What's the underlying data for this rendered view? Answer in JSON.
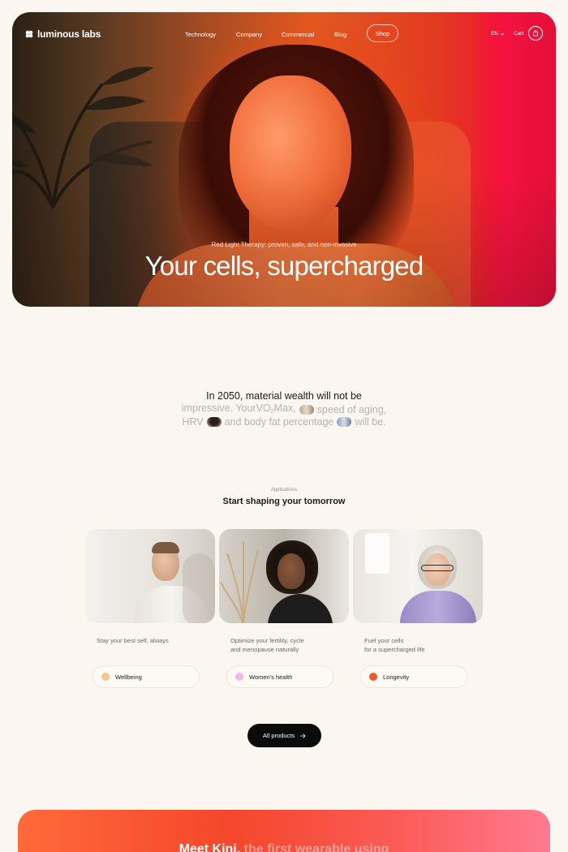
{
  "brand": {
    "name": "luminous labs",
    "logo_icon": "clover-logo-icon"
  },
  "nav": {
    "links": [
      "Technology",
      "Company",
      "Commercial",
      "Blog"
    ],
    "shop": "Shop",
    "language": "EN",
    "cart": "Cart"
  },
  "hero": {
    "subtitle": "Red Light Therapy: proven, safe, and non-invasive",
    "title": "Your cells, supercharged"
  },
  "statement": {
    "line1": "In 2050, material wealth will not be",
    "line2_a": "impressive. YourVO",
    "line2_sub": "2",
    "line2_b": "Max,",
    "line2_c": "speed of aging,",
    "line3_a": "HRV",
    "line3_b": "and body fat percentage",
    "line3_c": "will be."
  },
  "applications": {
    "eyebrow": "Applications",
    "title": "Start shaping your tomorrow",
    "cards": [
      {
        "desc": "Stay your best self, always",
        "label": "Wellbeing",
        "dot_color": "#f2c58a"
      },
      {
        "desc": "Optimize your fertility, cycle\nand menopause naturally",
        "label": "Women's health",
        "dot_color": "#f3b6e8"
      },
      {
        "desc": "Fuel your cells\nfor a supercharged life",
        "label": "Longevity",
        "dot_color": "#ec5a2a"
      }
    ],
    "cta": "All products"
  },
  "kini": {
    "title_a": "Meet Kini,",
    "title_b": "the first wearable using"
  },
  "colors": {
    "accent": "#f0401f",
    "background": "#fbf6ef",
    "button": "#0b0b0b"
  }
}
